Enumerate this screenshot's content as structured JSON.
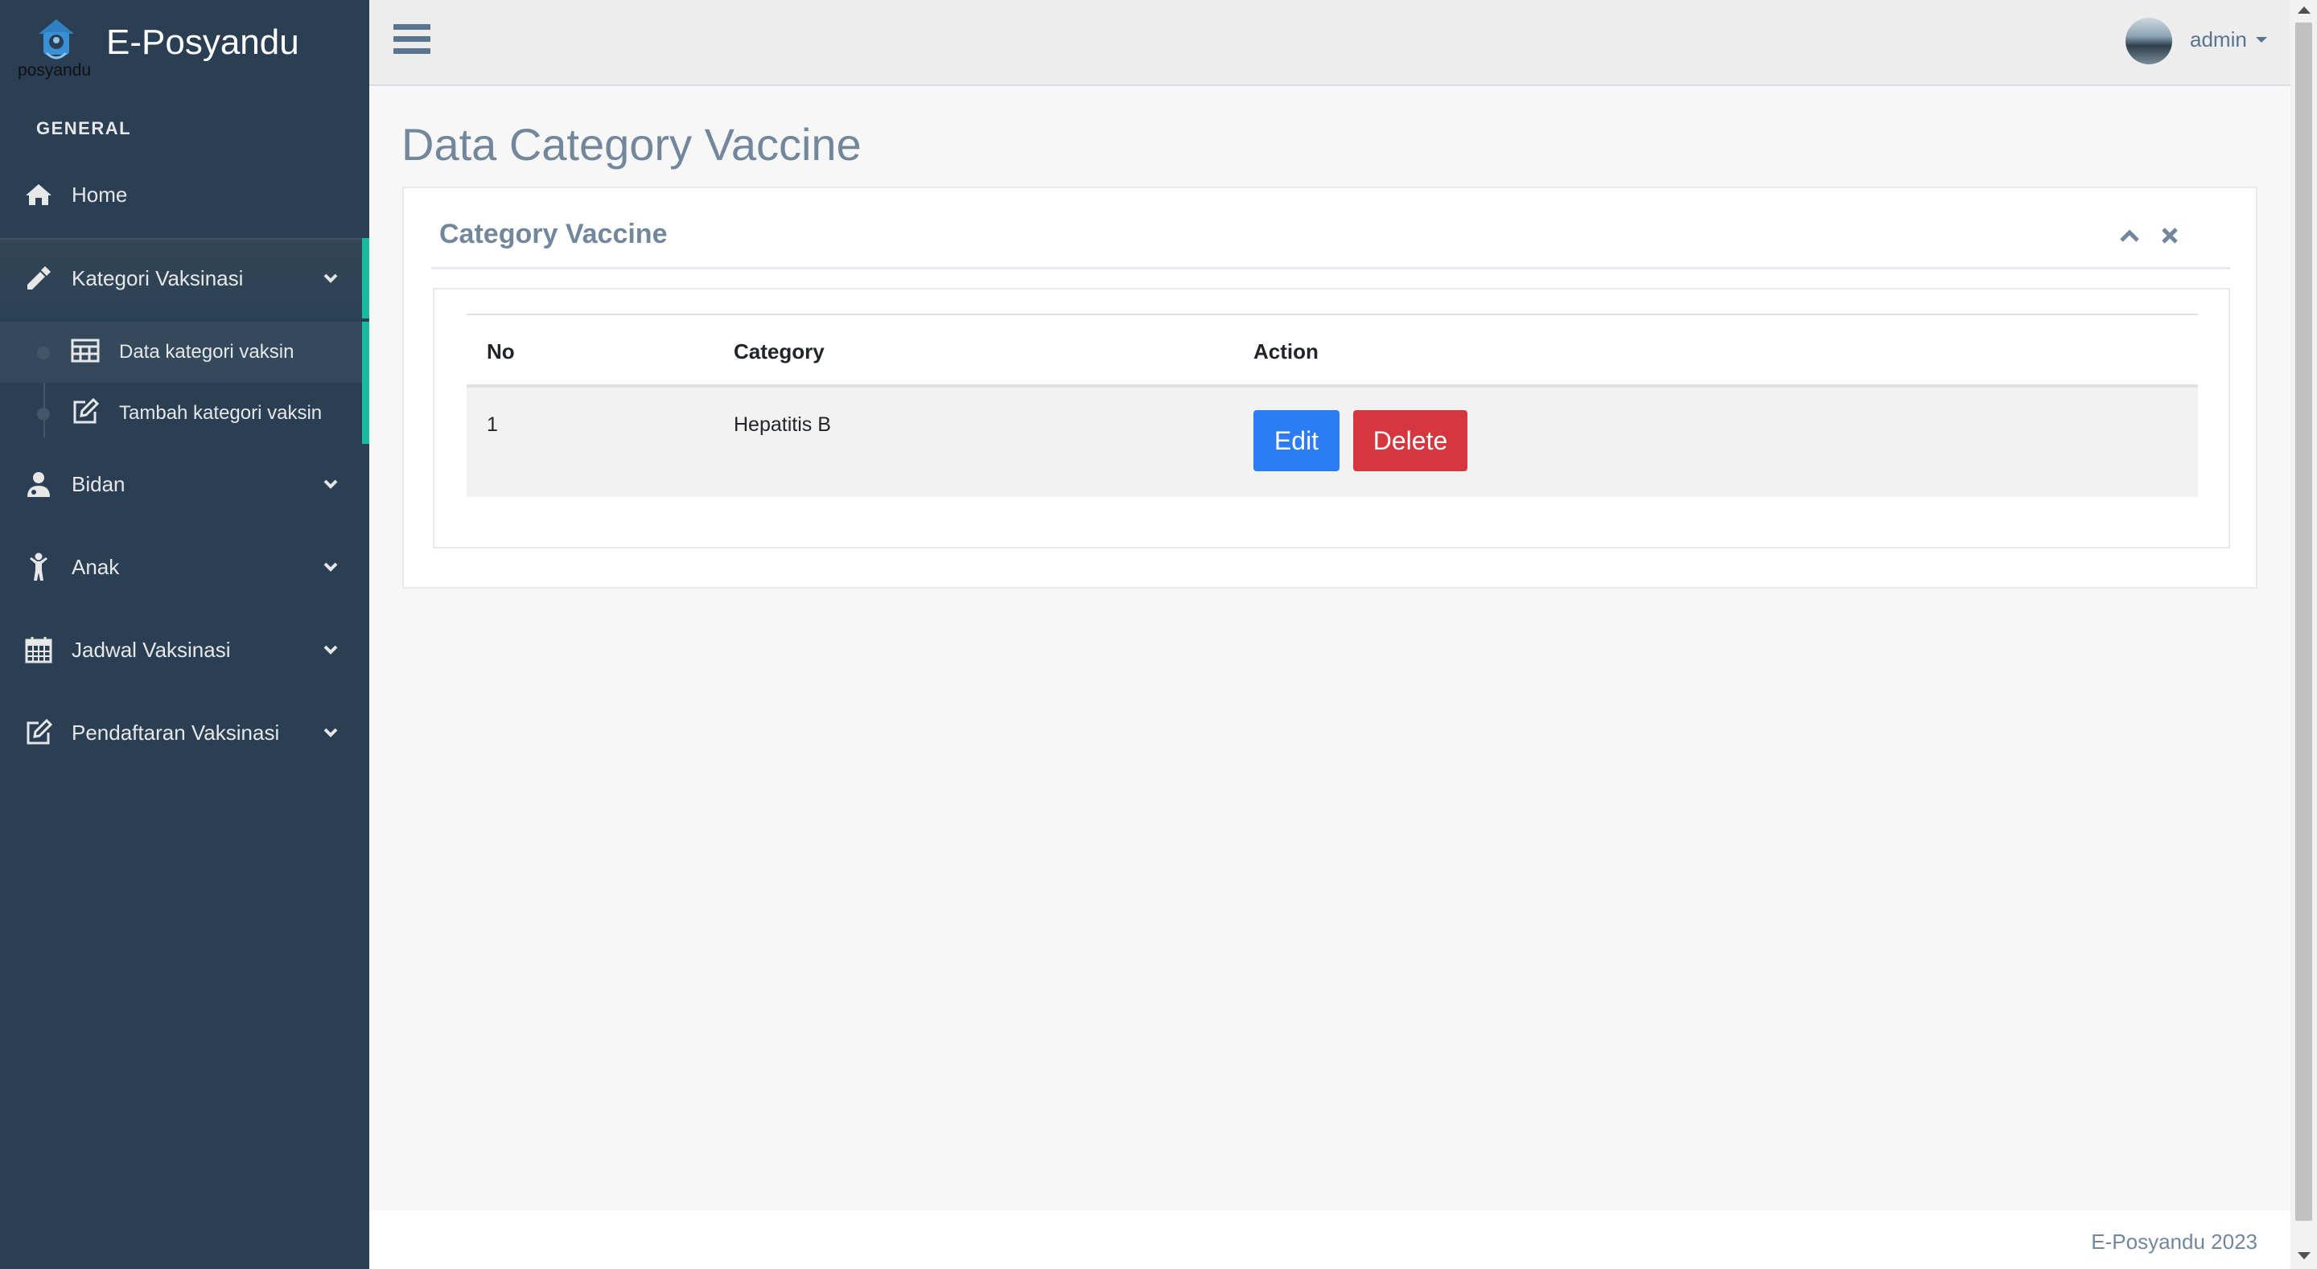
{
  "brand": {
    "logo_text": "posyandu",
    "title": "E-Posyandu"
  },
  "sidebar": {
    "section_label": "GENERAL",
    "items": [
      {
        "label": "Home",
        "icon": "home-icon"
      },
      {
        "label": "Kategori Vaksinasi",
        "icon": "eyedropper-icon",
        "expanded": true,
        "submenu": [
          {
            "label": "Data kategori vaksin",
            "icon": "table-icon",
            "current": true
          },
          {
            "label": "Tambah kategori vaksin",
            "icon": "edit-icon",
            "current": false
          }
        ]
      },
      {
        "label": "Bidan",
        "icon": "user-md-icon"
      },
      {
        "label": "Anak",
        "icon": "child-icon"
      },
      {
        "label": "Jadwal Vaksinasi",
        "icon": "calendar-icon"
      },
      {
        "label": "Pendaftaran Vaksinasi",
        "icon": "edit-icon"
      }
    ]
  },
  "topbar": {
    "user_name": "admin"
  },
  "main": {
    "page_title": "Data Category Vaccine",
    "panel": {
      "title": "Category Vaccine",
      "table": {
        "headers": [
          "No",
          "Category",
          "Action"
        ],
        "rows": [
          {
            "no": "1",
            "category": "Hepatitis B",
            "edit_label": "Edit",
            "delete_label": "Delete"
          }
        ]
      }
    }
  },
  "footer": {
    "text": "E-Posyandu 2023"
  },
  "colors": {
    "sidebar_bg": "#2a3f54",
    "active_accent": "#1abb9c",
    "edit_button": "#2b7cf5",
    "delete_button": "#d4383e"
  }
}
